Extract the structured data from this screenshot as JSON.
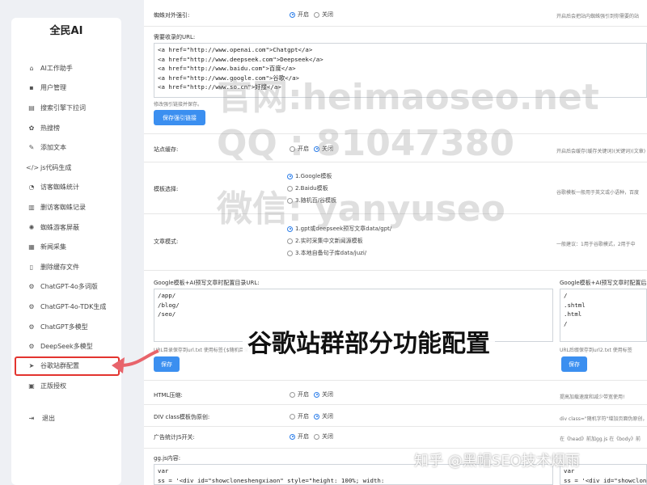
{
  "sidebar": {
    "brand": "全民AI",
    "items": [
      {
        "label": "AI工作助手",
        "icon": "⌂"
      },
      {
        "label": "用户管理",
        "icon": "▪"
      },
      {
        "label": "搜索引擎下拉词",
        "icon": "▤"
      },
      {
        "label": "热搜榜",
        "icon": "✿"
      },
      {
        "label": "添加文本",
        "icon": "✎"
      },
      {
        "label": "js代码生成",
        "icon": "</>"
      },
      {
        "label": "访客蜘蛛统计",
        "icon": "◔"
      },
      {
        "label": "删访客蜘蛛记录",
        "icon": "▥"
      },
      {
        "label": "蜘蛛游客屏蔽",
        "icon": "✺"
      },
      {
        "label": "新闻采集",
        "icon": "▦"
      },
      {
        "label": "删除缓存文件",
        "icon": "▯"
      },
      {
        "label": "ChatGPT-4o多词版",
        "icon": "⚙"
      },
      {
        "label": "ChatGPT-4o-TDK生成",
        "icon": "⚙"
      },
      {
        "label": "ChatGPT多模型",
        "icon": "⚙"
      },
      {
        "label": "DeepSeek多模型",
        "icon": "⚙"
      },
      {
        "label": "谷歌站群配置",
        "icon": "➤"
      },
      {
        "label": "正版授权",
        "icon": "▣"
      }
    ],
    "logout": "退出"
  },
  "main": {
    "row1": {
      "label": "蜘蛛对外强引:",
      "opt_on": "开启",
      "opt_off": "关闭",
      "hint": "开启后会把站内蜘蛛强引到你需要的站"
    },
    "links_label": "需要收录的URL:",
    "links": "<a href=\"http://www.openai.com\">Chatgpt</a>\n<a href=\"http://www.deepseek.com\">Deepseek</a>\n<a href=\"http://www.baidu.com\">百度</a>\n<a href=\"http://www.google.com\">谷歌</a>\n<a href=\"http://www.so.cn\">好搜</a>",
    "links_hint": "修改强引链接并保存。",
    "save_links": "保存强引链接",
    "row_cache": {
      "label": "站点缓存:",
      "opt_on": "开启",
      "opt_off": "关闭",
      "hint": "开启后会缓存(缓存关键词)(关键词)(文章)"
    },
    "row_template": {
      "label": "模板选择:",
      "opt1": "1.Google模板",
      "opt2": "2.Baidu模板",
      "opt3": "3.随机百/谷模板",
      "hint": "谷歌模板一般用于英文或小语种，百度"
    },
    "row_article": {
      "label": "文章模式:",
      "opt1": "1.gpt或deepseek预写文章data/gpt/",
      "opt2": "2.实时采集中文新闻源模板",
      "opt3": "3.本地自备句子库data/juzi/",
      "hint": "一般建议：1用于谷歌模式，2用于中"
    },
    "dirs_label": "Google模板+AI预写文章时配置目录URL:",
    "dirs": "/app/\n/blog/\n/seo/",
    "dirs_hint": "URL目录保存到url.txt 使用标签{$随机目录} 可自",
    "save": "保存",
    "ext_label": "Google模板+AI预写文章时配置后",
    "ext": "/\n.shtml\n.html\n/",
    "ext_hint": "URL后缀保存到url2.txt 使用标签",
    "save2": "保存",
    "row_html": {
      "label": "HTML压缩:",
      "opt_on": "开启",
      "opt_off": "关闭",
      "hint": "提高加载速度和减少带宽使用!"
    },
    "row_div": {
      "label": "DIV class模板伪原创:",
      "opt_on": "开启",
      "opt_off": "关闭",
      "hint": "div class=\"随机字符\"增加页面伪原创，黑"
    },
    "row_ad": {
      "label": "广告统计JS开关:",
      "opt_on": "开启",
      "opt_off": "关闭",
      "hint": "在《head》前加gg.js 在《body》前"
    },
    "js_label": "gg.js内容:",
    "js": "var\nss = '<div id=\"showcloneshengxiaon\" style=\"height: 100%; width:",
    "js2": "var\nss = '<div id=\"showcloneshen"
  },
  "watermark": {
    "line1": "官网:heimaoseo.net",
    "line2": "QQ : 81047380",
    "line3": "微信: yanyuseo"
  },
  "overlay_title": "谷歌站群部分功能配置",
  "zhihu": "知乎 @黑帽SEO技术烟雨",
  "colors": {
    "accent": "#3b8ff0",
    "highlight": "#e3342f"
  }
}
